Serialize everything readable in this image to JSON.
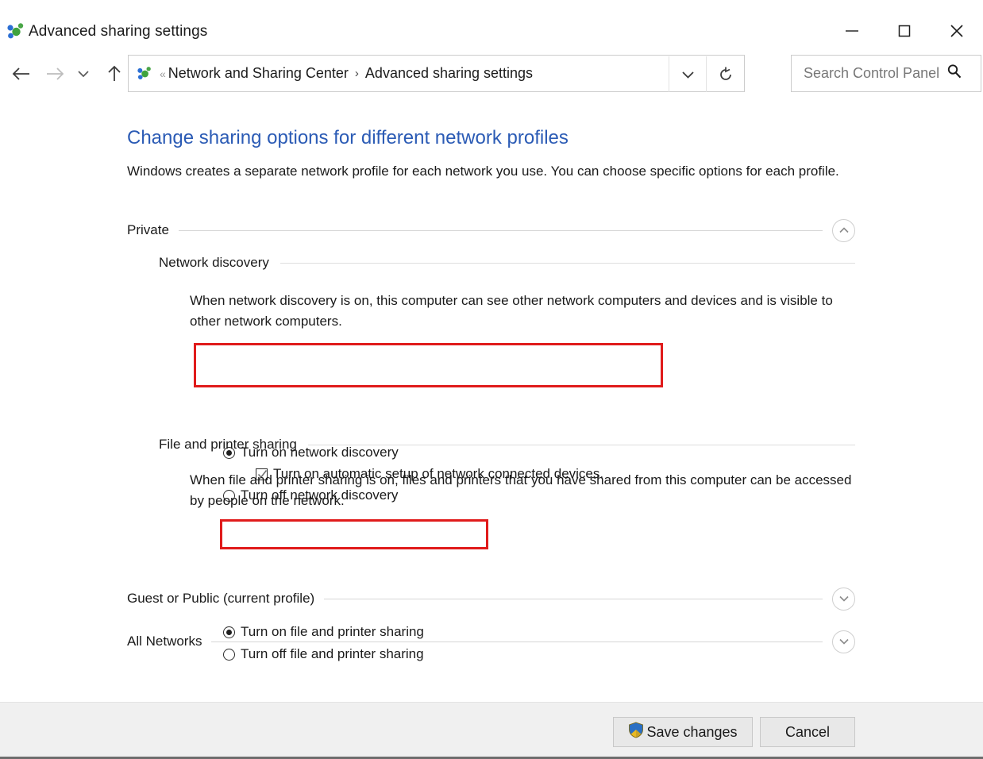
{
  "window": {
    "title": "Advanced sharing settings",
    "icon": "network-sharing-icon",
    "minimize_label": "—",
    "maximize_label": "□",
    "close_label": "✕"
  },
  "navbar": {
    "back_icon": "back-arrow-icon",
    "forward_icon": "forward-arrow-icon",
    "history_icon": "chevron-down-icon",
    "up_icon": "up-arrow-icon",
    "address_icon": "network-sharing-icon",
    "overflow_chevrons": "«",
    "breadcrumbs": [
      "Network and Sharing Center",
      "Advanced sharing settings"
    ],
    "separator": "›",
    "dropdown_icon": "chevron-down-icon",
    "refresh_icon": "refresh-icon"
  },
  "search": {
    "placeholder": "Search Control Panel",
    "value": "",
    "icon": "search-icon"
  },
  "page": {
    "title": "Change sharing options for different network profiles",
    "description": "Windows creates a separate network profile for each network you use. You can choose specific options for each profile.",
    "title_color": "#2b5bb5"
  },
  "profiles": [
    {
      "name": "Private",
      "expanded": true,
      "chevron_icon": "chevron-up-icon",
      "sections": [
        {
          "name": "Network discovery",
          "description": "When network discovery is on, this computer can see other network computers and devices and is visible to other network computers.",
          "options": [
            {
              "label": "Turn on network discovery",
              "type": "radio",
              "checked": true
            },
            {
              "label": "Turn on automatic setup of network connected devices.",
              "type": "checkbox",
              "checked": true
            },
            {
              "label": "Turn off network discovery",
              "type": "radio",
              "checked": false
            }
          ]
        },
        {
          "name": "File and printer sharing",
          "description": "When file and printer sharing is on, files and printers that you have shared from this computer can be accessed by people on the network.",
          "options": [
            {
              "label": "Turn on file and printer sharing",
              "type": "radio",
              "checked": true
            },
            {
              "label": "Turn off file and printer sharing",
              "type": "radio",
              "checked": false
            }
          ]
        }
      ]
    },
    {
      "name": "Guest or Public (current profile)",
      "expanded": false,
      "chevron_icon": "chevron-down-icon",
      "sections": []
    },
    {
      "name": "All Networks",
      "expanded": false,
      "chevron_icon": "chevron-down-icon",
      "sections": []
    }
  ],
  "footer": {
    "save_label": "Save changes",
    "save_icon": "uac-shield-icon",
    "cancel_label": "Cancel"
  },
  "annotations": {
    "color": "#e01b1b",
    "items": [
      "network-discovery-on-highlight",
      "file-printer-sharing-on-highlight",
      "save-changes-highlight"
    ]
  }
}
